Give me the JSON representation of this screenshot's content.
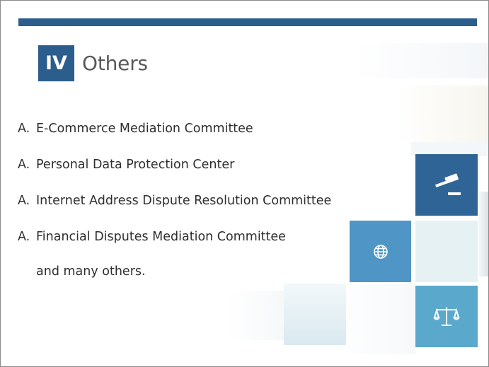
{
  "section": {
    "numeral": "IV",
    "title": "Others"
  },
  "items": [
    {
      "marker": "A.",
      "label": "E-Commerce Mediation Committee"
    },
    {
      "marker": "A.",
      "label": "Personal Data Protection Center"
    },
    {
      "marker": "A.",
      "label": "Internet Address Dispute Resolution Committee"
    },
    {
      "marker": "A.",
      "label": "Financial Disputes Mediation Committee"
    }
  ],
  "tail_text": "and many others.",
  "decor": {
    "icons": [
      "gavel-icon",
      "globe-icon",
      "scales-icon"
    ],
    "colors": {
      "dark_blue": "#2b5d8d",
      "mid_blue": "#4f95c6",
      "light_blue": "#5ba9cc",
      "pale_tile": "#e9f2f4"
    }
  }
}
